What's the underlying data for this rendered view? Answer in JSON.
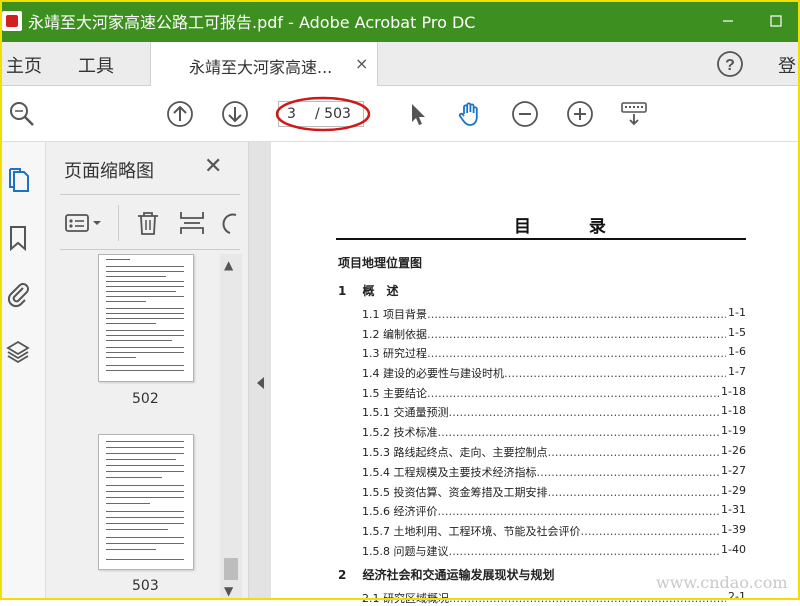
{
  "window": {
    "title": "永靖至大河家高速公路工可报告.pdf - Adobe Acrobat Pro DC"
  },
  "menubar": {
    "home": "主页",
    "tools": "工具",
    "doc_tab": "永靖至大河家高速...",
    "doc_tab_close": "×",
    "login": "登"
  },
  "toolbar": {
    "page_current": "3",
    "page_total": "/ 503",
    "icons": [
      "zoom-search-icon",
      "page-up-icon",
      "page-down-icon",
      "select-cursor-icon",
      "hand-tool-icon",
      "zoom-out-icon",
      "zoom-in-icon",
      "keyboard-icon"
    ]
  },
  "thumbnails": {
    "title": "页面缩略图",
    "close": "✕",
    "pages": [
      "502",
      "503"
    ]
  },
  "toc": {
    "heading": "目 录",
    "lines": [
      {
        "text": "项目地理位置图",
        "page": "",
        "style": "bold"
      },
      {
        "text": "1　 概　述",
        "page": "",
        "style": "bold"
      },
      {
        "text": "1.1 项目背景",
        "page": "1-1",
        "style": "entry"
      },
      {
        "text": "1.2 编制依据",
        "page": "1-5",
        "style": "entry"
      },
      {
        "text": "1.3 研究过程",
        "page": "1-6",
        "style": "entry"
      },
      {
        "text": "1.4 建设的必要性与建设时机",
        "page": "1-7",
        "style": "entry"
      },
      {
        "text": "1.5 主要结论",
        "page": "1-18",
        "style": "entry"
      },
      {
        "text": "1.5.1 交通量预测",
        "page": "1-18",
        "style": "entry"
      },
      {
        "text": "1.5.2 技术标准",
        "page": "1-19",
        "style": "entry"
      },
      {
        "text": "1.5.3 路线起终点、走向、主要控制点",
        "page": "1-26",
        "style": "entry"
      },
      {
        "text": "1.5.4 工程规模及主要技术经济指标",
        "page": "1-27",
        "style": "entry"
      },
      {
        "text": "1.5.5 投资估算、资金筹措及工期安排",
        "page": "1-29",
        "style": "entry"
      },
      {
        "text": "1.5.6 经济评价",
        "page": "1-31",
        "style": "entry"
      },
      {
        "text": "1.5.7 土地利用、工程环境、节能及社会评价",
        "page": "1-39",
        "style": "entry"
      },
      {
        "text": "1.5.8 问题与建议",
        "page": "1-40",
        "style": "entry"
      },
      {
        "text": "2　 经济社会和交通运输发展现状与规划",
        "page": "",
        "style": "bold"
      },
      {
        "text": "2.1 研究区域概况",
        "page": "2-1",
        "style": "entry"
      }
    ]
  },
  "watermark": "www.cndao.com",
  "colors": {
    "titlebar": "#3d8f1f",
    "highlight": "#d01818"
  }
}
